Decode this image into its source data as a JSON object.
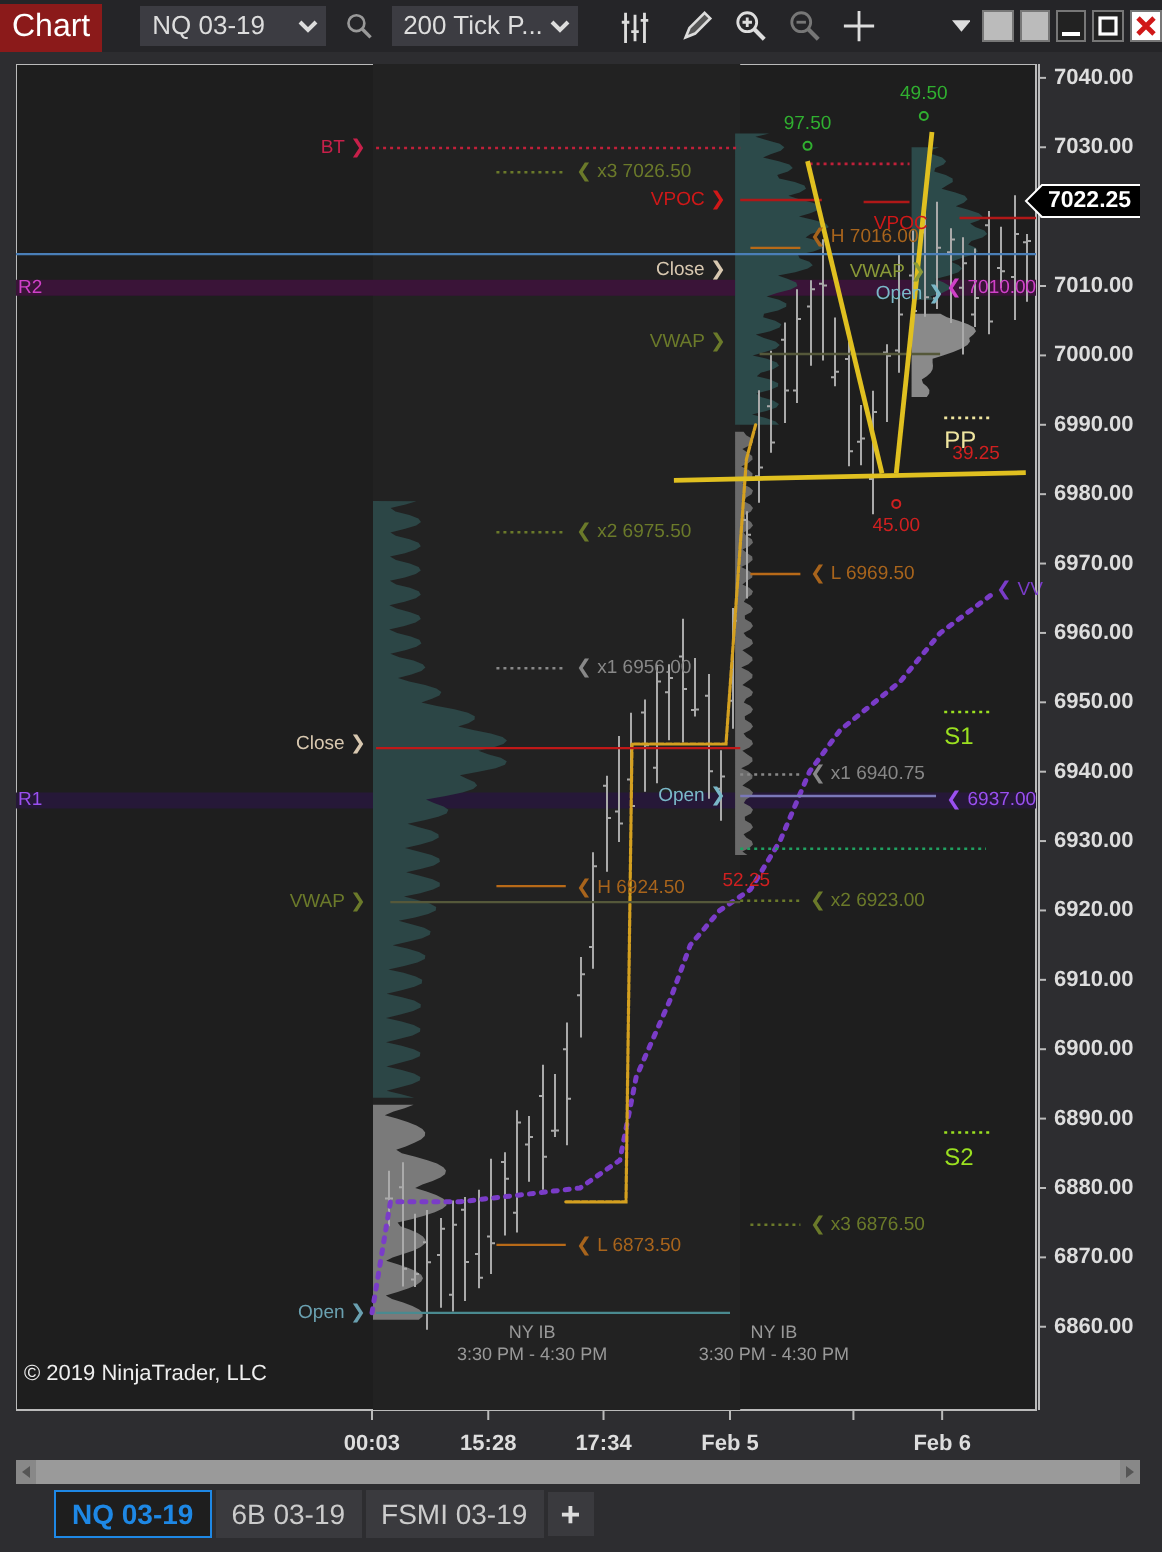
{
  "toolbar": {
    "app_button": "Chart",
    "instrument": "NQ 03-19",
    "bar_type": "200 Tick P..."
  },
  "chart": {
    "copyright": "© 2019 NinjaTrader, LLC",
    "price_tag": "7022.25",
    "price_axis": [
      "7040.00",
      "7030.00",
      "7010.00",
      "7000.00",
      "6990.00",
      "6980.00",
      "6970.00",
      "6960.00",
      "6950.00",
      "6940.00",
      "6930.00",
      "6920.00",
      "6910.00",
      "6900.00",
      "6890.00",
      "6880.00",
      "6870.00",
      "6860.00"
    ],
    "time_axis": [
      "00:03",
      "15:28",
      "17:34",
      "Feb 5",
      "Feb 6"
    ],
    "session_labels": [
      {
        "title": "NY IB",
        "time": "3:30 PM - 4:30 PM"
      },
      {
        "title": "NY IB",
        "time": "3:30 PM - 4:30 PM"
      }
    ],
    "level_labels": [
      {
        "kind": "label",
        "text": "R2",
        "color": "#d040c8"
      },
      {
        "kind": "label",
        "text": "BT ❯",
        "color": "#c8204a"
      },
      {
        "kind": "label",
        "text": "❮ x3 7026.50",
        "color": "#6b7a2a"
      },
      {
        "kind": "label",
        "text": "97.50",
        "color": "#30b030"
      },
      {
        "kind": "label",
        "text": "49.50",
        "color": "#30b030"
      },
      {
        "kind": "label",
        "text": "VPOC ❯",
        "color": "#d01818"
      },
      {
        "kind": "label",
        "text": "VPOC",
        "color": "#d01818"
      },
      {
        "kind": "label",
        "text": "❮ H 7016.00",
        "color": "#a8641c"
      },
      {
        "kind": "label",
        "text": "Close ❯",
        "color": "#d8c8b0"
      },
      {
        "kind": "label",
        "text": "VWAP ❯",
        "color": "#8a9a38"
      },
      {
        "kind": "label",
        "text": "Open ❯",
        "color": "#7ab8c8"
      },
      {
        "kind": "label",
        "text": "❮ 7010.00",
        "color": "#d040c8"
      },
      {
        "kind": "label",
        "text": "VWAP ❯",
        "color": "#6b7a2a"
      },
      {
        "kind": "pivot",
        "text": "PP",
        "color": "#f0e6a0"
      },
      {
        "kind": "label",
        "text": "39.25",
        "color": "#d02020"
      },
      {
        "kind": "label",
        "text": "45.00",
        "color": "#d02020"
      },
      {
        "kind": "label",
        "text": "❮ x2 6975.50",
        "color": "#6b7a2a"
      },
      {
        "kind": "label",
        "text": "❮ L 6969.50",
        "color": "#a8641c"
      },
      {
        "kind": "label",
        "text": "❮ VV",
        "color": "#7a3cc8"
      },
      {
        "kind": "label",
        "text": "❮ x1 6956.00",
        "color": "#888888"
      },
      {
        "kind": "pivot",
        "text": "S1",
        "color": "#9be020"
      },
      {
        "kind": "label",
        "text": "Close ❯",
        "color": "#d8c8b0"
      },
      {
        "kind": "label",
        "text": "❮ x1 6940.75",
        "color": "#888888"
      },
      {
        "kind": "label",
        "text": "R1",
        "color": "#9a50f0"
      },
      {
        "kind": "label",
        "text": "Open ❯",
        "color": "#7ab8c8"
      },
      {
        "kind": "label",
        "text": "❮ 6937.00",
        "color": "#9a50f0"
      },
      {
        "kind": "label",
        "text": "❮ H 6924.50",
        "color": "#a8641c"
      },
      {
        "kind": "label",
        "text": "52.25",
        "color": "#d02020"
      },
      {
        "kind": "label",
        "text": "VWAP ❯",
        "color": "#6b7a2a"
      },
      {
        "kind": "label",
        "text": "❮ x2 6923.00",
        "color": "#6b7a2a"
      },
      {
        "kind": "pivot",
        "text": "S2",
        "color": "#9be020"
      },
      {
        "kind": "label",
        "text": "❮ x3 6876.50",
        "color": "#6b7a2a"
      },
      {
        "kind": "label",
        "text": "❮ L 6873.50",
        "color": "#a8641c"
      },
      {
        "kind": "label",
        "text": "Open ❯",
        "color": "#6aa0b0"
      }
    ]
  },
  "tabs": [
    {
      "label": "NQ 03-19",
      "selected": true
    },
    {
      "label": "6B 03-19",
      "selected": false
    },
    {
      "label": "FSMI 03-19",
      "selected": false
    }
  ],
  "add_tab": "+"
}
